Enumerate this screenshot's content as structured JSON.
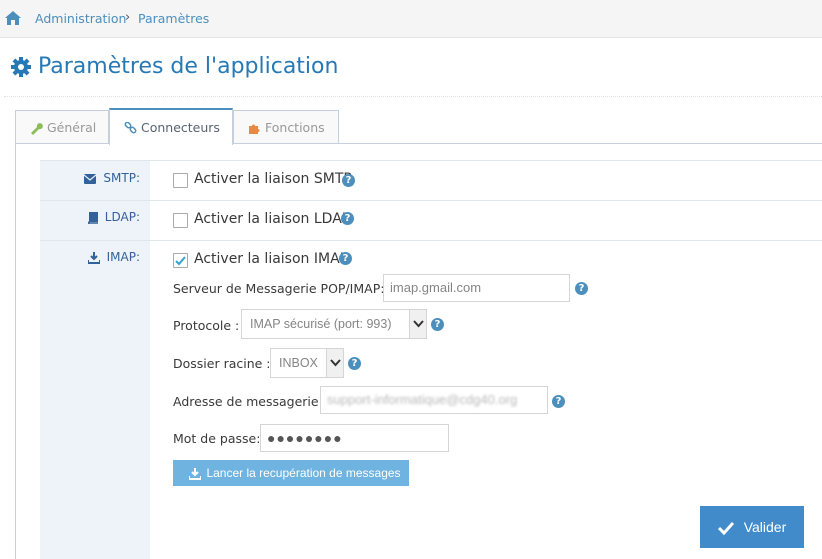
{
  "breadcrumb": {
    "home_icon": "home-icon",
    "items": [
      "Administration",
      "Paramètres"
    ],
    "separator": "›"
  },
  "page": {
    "title": "Paramètres de l'application",
    "title_icon": "gear-icon"
  },
  "tabs": [
    {
      "label": "Général",
      "icon": "wrench-icon",
      "active": false
    },
    {
      "label": "Connecteurs",
      "icon": "link-icon",
      "active": true
    },
    {
      "label": "Fonctions",
      "icon": "puzzle-icon",
      "active": false
    }
  ],
  "connectors": {
    "smtp": {
      "label": "SMTP:",
      "icon": "envelope-icon",
      "checkbox_label": "Activer la liaison SMTP",
      "checked": false
    },
    "ldap": {
      "label": "LDAP:",
      "icon": "book-icon",
      "checkbox_label": "Activer la liaison LDAP",
      "checked": false
    },
    "imap": {
      "label": "IMAP:",
      "icon": "download-icon",
      "checkbox_label": "Activer la liaison IMAP",
      "checked": true
    }
  },
  "imap_form": {
    "server_label": "Serveur de Messagerie POP/IMAP:",
    "server_value": "imap.gmail.com",
    "protocol_label": "Protocole :",
    "protocol_value": "IMAP sécurisé (port: 993)",
    "folder_label": "Dossier racine :",
    "folder_value": "INBOX",
    "email_label": "Adresse de messagerie:",
    "email_value": "support-informatique@cdg40.org",
    "password_label": "Mot de passe:",
    "password_value": "●●●●●●●●",
    "fetch_button": "Lancer la recupération de messages"
  },
  "actions": {
    "submit_label": "Valider"
  },
  "colors": {
    "link": "#4c8fbd",
    "title": "#2679b5",
    "label_column": "#edf3f8",
    "primary_button": "#428bca",
    "fetch_button": "#6fb3e0"
  }
}
